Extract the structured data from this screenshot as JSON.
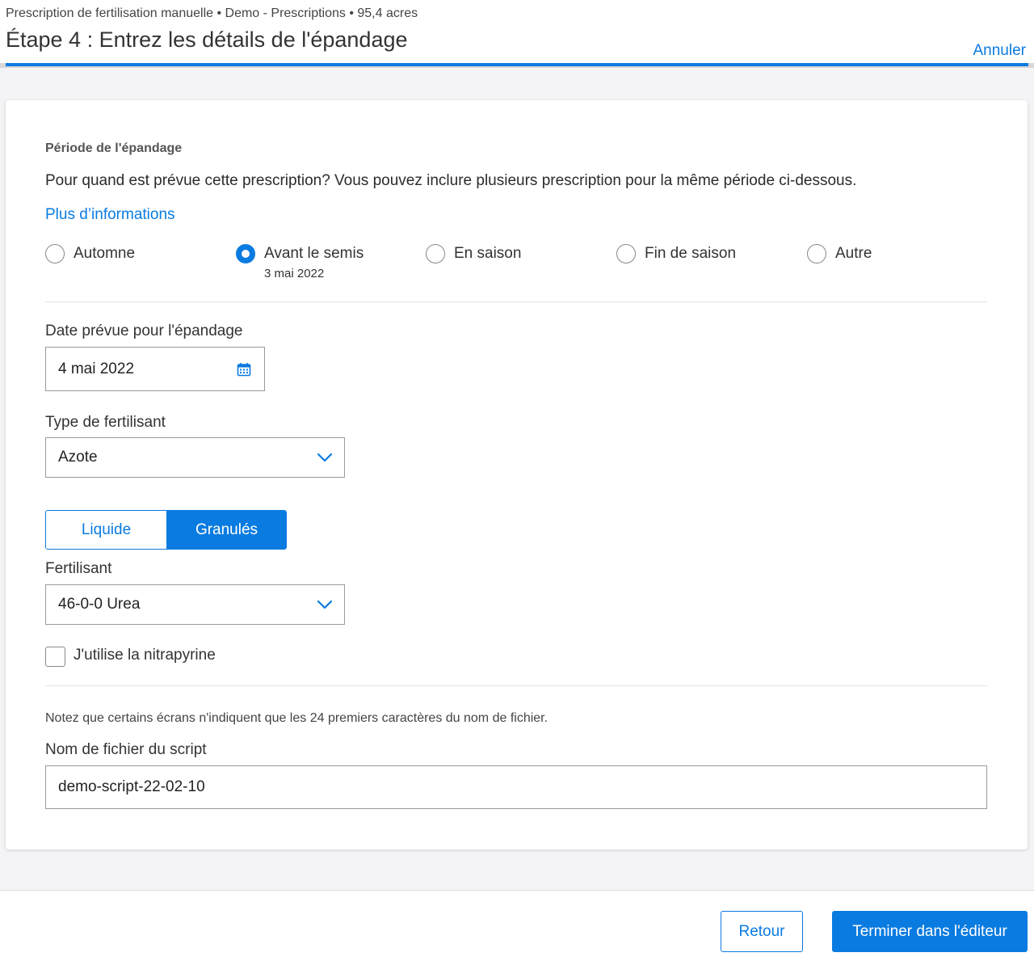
{
  "header": {
    "breadcrumb": "Prescription de fertilisation manuelle • Demo - Prescriptions • 95,4 acres",
    "title": "Étape 4 : Entrez les détails de l'épandage",
    "cancel_label": "Annuler",
    "progress": 1.0
  },
  "period": {
    "section_title": "Période de l'épandage",
    "question": "Pour quand est prévue cette prescription? Vous pouvez inclure plusieurs prescription pour la même période ci-dessous.",
    "more_info_label": "Plus d’informations",
    "options": [
      {
        "label": "Automne",
        "sub": "",
        "checked": false
      },
      {
        "label": "Avant le semis",
        "sub": "3 mai 2022",
        "checked": true
      },
      {
        "label": "En saison",
        "sub": "",
        "checked": false
      },
      {
        "label": "Fin de saison",
        "sub": "",
        "checked": false
      },
      {
        "label": "Autre",
        "sub": "",
        "checked": false
      }
    ]
  },
  "date_field": {
    "label": "Date prévue pour l'épandage",
    "value": "4 mai 2022"
  },
  "fertilizer_type": {
    "label": "Type de fertilisant",
    "selected": "Azote"
  },
  "form_toggle": {
    "liquid_label": "Liquide",
    "granular_label": "Granulés",
    "selected": "Granulés"
  },
  "fertilizer": {
    "label": "Fertilisant",
    "selected": "46-0-0 Urea"
  },
  "nitrapyrin": {
    "label": "J'utilise la nitrapyrine",
    "checked": false
  },
  "script": {
    "note": "Notez que certains écrans n'indiquent que les 24 premiers caractères du nom de fichier.",
    "label": "Nom de fichier du script",
    "value": "demo-script-22-02-10"
  },
  "footer": {
    "back_label": "Retour",
    "finish_label": "Terminer dans l'éditeur"
  },
  "colors": {
    "accent": "#0a7be0",
    "background": "#f4f3f5"
  }
}
